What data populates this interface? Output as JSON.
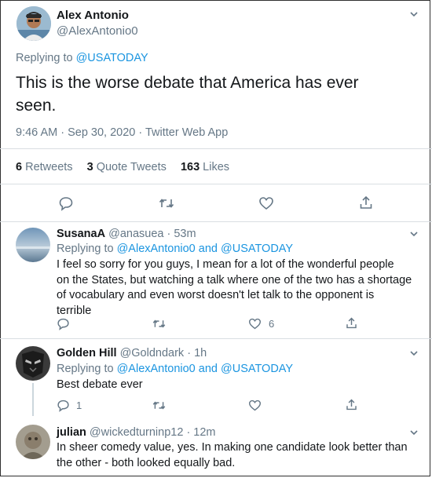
{
  "main": {
    "author_name": "Alex Antonio",
    "author_handle": "@AlexAntonio0",
    "replying_prefix": "Replying to",
    "replying_handle": "@USATODAY",
    "text_line1": "This is the worse debate that America has ever",
    "text_line2": "seen.",
    "meta": "9:46 AM · Sep 30, 2020 · Twitter Web App",
    "retweets_count": "6",
    "retweets_label": "Retweets",
    "quotes_count": "3",
    "quotes_label": "Quote Tweets",
    "likes_count": "163",
    "likes_label": "Likes"
  },
  "replies": [
    {
      "name": "SusanaA",
      "handle_time": "@anasuea · 53m",
      "replying_prefix": "Replying to",
      "replying_handles": "@AlexAntonio0 and @USATODAY",
      "lines": [
        "I feel so sorry for you guys, I mean for a lot of the wonderful people",
        "on the States, but watching a talk where one of the two has a shortage",
        "of vocabulary and even worst doesn't let talk to the opponent is",
        "terrible"
      ],
      "like_count": "6"
    },
    {
      "name": "Golden Hill",
      "handle_time": "@Goldndark · 1h",
      "replying_prefix": "Replying to",
      "replying_handles": "@AlexAntonio0 and @USATODAY",
      "lines": [
        "Best debate ever"
      ],
      "reply_count": "1"
    },
    {
      "name": "julian",
      "handle_time": "@wickedturninp12 · 12m",
      "lines": [
        "In sheer comedy value, yes. In making one candidate look better than",
        "the other - both looked equally bad."
      ]
    }
  ],
  "colors": {
    "accent": "#1b95e0",
    "muted": "#657786",
    "text": "#14171a"
  }
}
